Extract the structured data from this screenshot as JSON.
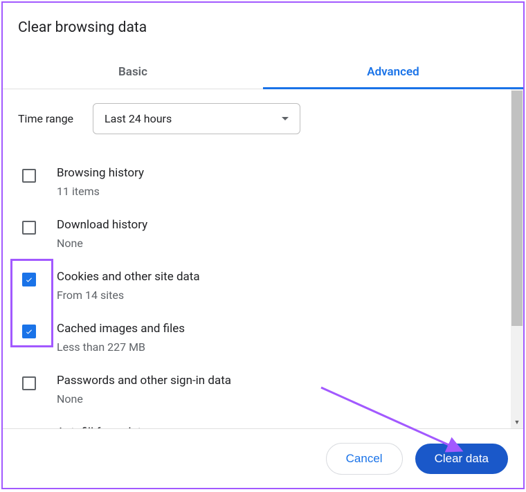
{
  "title": "Clear browsing data",
  "tabs": {
    "basic": "Basic",
    "advanced": "Advanced"
  },
  "time": {
    "label": "Time range",
    "selected": "Last 24 hours"
  },
  "items": [
    {
      "checked": false,
      "primary": "Browsing history",
      "secondary": "11 items"
    },
    {
      "checked": false,
      "primary": "Download history",
      "secondary": "None"
    },
    {
      "checked": true,
      "primary": "Cookies and other site data",
      "secondary": "From 14 sites"
    },
    {
      "checked": true,
      "primary": "Cached images and files",
      "secondary": "Less than 227 MB"
    },
    {
      "checked": false,
      "primary": "Passwords and other sign-in data",
      "secondary": "None"
    },
    {
      "checked": false,
      "primary": "Autofill form data",
      "secondary": ""
    }
  ],
  "buttons": {
    "cancel": "Cancel",
    "clear": "Clear data"
  }
}
